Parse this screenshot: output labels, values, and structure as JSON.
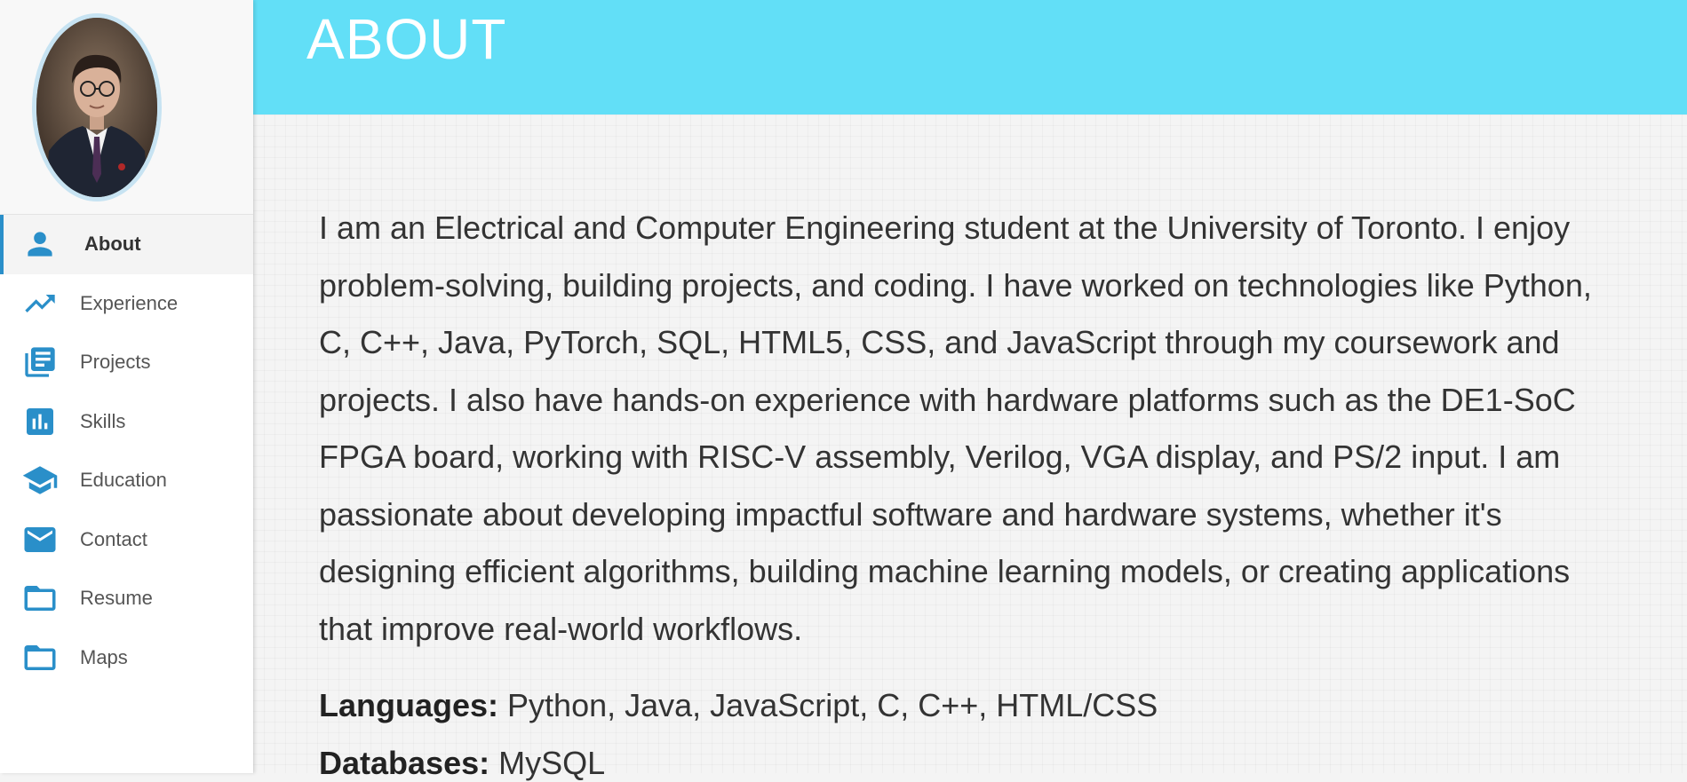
{
  "sidebar": {
    "profile_photo": "profile-photo",
    "items": [
      {
        "label": "About",
        "icon": "person-icon",
        "active": true
      },
      {
        "label": "Experience",
        "icon": "trending-up-icon",
        "active": false
      },
      {
        "label": "Projects",
        "icon": "article-icon",
        "active": false
      },
      {
        "label": "Skills",
        "icon": "bar-chart-icon",
        "active": false
      },
      {
        "label": "Education",
        "icon": "school-icon",
        "active": false
      },
      {
        "label": "Contact",
        "icon": "mail-icon",
        "active": false
      },
      {
        "label": "Resume",
        "icon": "folder-icon",
        "active": false
      },
      {
        "label": "Maps",
        "icon": "folder-icon",
        "active": false
      }
    ]
  },
  "header": {
    "title": "ABOUT"
  },
  "main": {
    "about_text": "I am an Electrical and Computer Engineering student at the University of Toronto. I enjoy problem-solving, building projects, and coding. I have worked on technologies like Python, C, C++, Java, PyTorch, SQL, HTML5, CSS, and JavaScript through my coursework and projects. I also have hands-on experience with hardware platforms such as the DE1-SoC FPGA board, working with RISC-V assembly, Verilog, VGA display, and PS/2 input. I am passionate about developing impactful software and hardware systems, whether it's designing efficient algorithms, building machine learning models, or creating applications that improve real-world workflows.",
    "languages_label": "Languages:",
    "languages_value": "Python, Java, JavaScript, C, C++, HTML/CSS",
    "databases_label": "Databases:",
    "databases_value": "MySQL"
  },
  "colors": {
    "header": "#62dff7",
    "icon": "#2a8fc9",
    "active_indicator": "#2a8fc9"
  }
}
